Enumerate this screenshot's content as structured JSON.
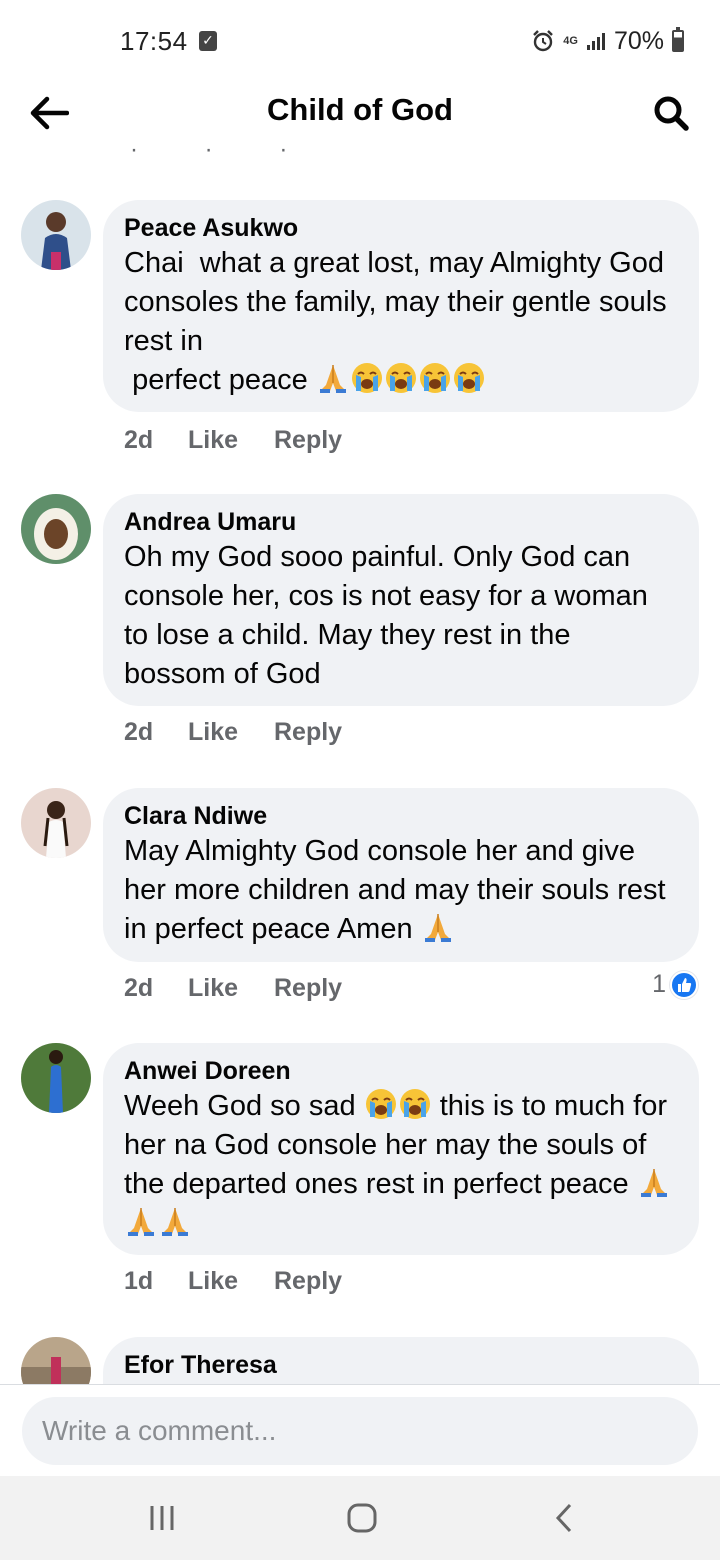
{
  "status_bar": {
    "time": "17:54",
    "network": "4G",
    "battery": "70%"
  },
  "header": {
    "title": "Child of God",
    "back_icon": "arrow-left-icon",
    "search_icon": "search-icon"
  },
  "comments": [
    {
      "author": "Peace Asukwo",
      "text": "Chai  what a great lost, may Almighty God consoles the family, may their gentle souls rest in\n perfect peace",
      "emojis": [
        "folded-hands",
        "loudly-crying",
        "loudly-crying",
        "loudly-crying",
        "loudly-crying"
      ],
      "time": "2d",
      "like_label": "Like",
      "reply_label": "Reply"
    },
    {
      "author": "Andrea Umaru",
      "text": "Oh my God sooo painful. Only God can console her, cos is not easy for a woman to lose a child. May they rest in the bossom of God",
      "emojis": [],
      "time": "2d",
      "like_label": "Like",
      "reply_label": "Reply"
    },
    {
      "author": "Clara Ndiwe",
      "text": "May Almighty God console her and give her more children and may their souls rest in perfect peace Amen",
      "emojis": [
        "folded-hands"
      ],
      "time": "2d",
      "like_label": "Like",
      "reply_label": "Reply",
      "reaction_count": "1"
    },
    {
      "author": "Anwei Doreen",
      "text_before": "Weeh God so sad",
      "text_before_emojis": [
        "loudly-crying",
        "loudly-crying"
      ],
      "text": "this is to much for her na God console her may the souls of the departed ones rest in perfect peace",
      "emojis": [
        "folded-hands",
        "folded-hands",
        "folded-hands"
      ],
      "time": "1d",
      "like_label": "Like",
      "reply_label": "Reply"
    },
    {
      "author": "Efor Theresa"
    }
  ],
  "composer": {
    "placeholder": "Write a comment..."
  },
  "nav_bar": {
    "recents_icon": "recent-apps-icon",
    "home_icon": "home-icon",
    "back_icon": "back-chevron-icon"
  },
  "colors": {
    "bubble": "#f0f2f5",
    "muted_text": "#65676b",
    "like_blue": "#1877f2"
  }
}
